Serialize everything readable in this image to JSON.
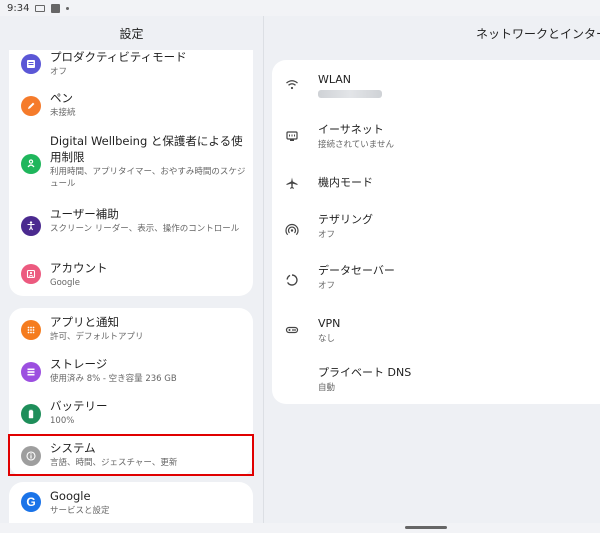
{
  "status_bar": {
    "time": "9:34"
  },
  "left_pane": {
    "title": "設定",
    "group1": [
      {
        "title": "プロダクティビティモード",
        "subtitle": "オフ",
        "icon": "list-icon",
        "color": "#5b57d6"
      },
      {
        "title": "ペン",
        "subtitle": "未接続",
        "icon": "pen-icon",
        "color": "#f57b2b"
      },
      {
        "title": "Digital Wellbeing と保護者による使用制限",
        "subtitle": "利用時間、アプリタイマー、おやすみ時間のスケジュール",
        "icon": "wellbeing-icon",
        "color": "#1fb65c"
      },
      {
        "title": "ユーザー補助",
        "subtitle": "スクリーン リーダー、表示、操作のコントロール",
        "icon": "accessibility-icon",
        "color": "#4b2a8f"
      },
      {
        "title": "アカウント",
        "subtitle": "Google",
        "icon": "account-icon",
        "color": "#ec5a7f"
      }
    ],
    "group2": [
      {
        "title": "アプリと通知",
        "subtitle": "許可、デフォルトアプリ",
        "icon": "apps-icon",
        "color": "#f57c1f"
      },
      {
        "title": "ストレージ",
        "subtitle": "使用済み 8% - 空き容量 236 GB",
        "icon": "storage-icon",
        "color": "#9c4fe0"
      },
      {
        "title": "バッテリー",
        "subtitle": "100%",
        "icon": "battery-icon",
        "color": "#1e8e5a"
      },
      {
        "title": "システム",
        "subtitle": "言語、時間、ジェスチャー、更新",
        "icon": "info-icon",
        "color": "#9e9e9e"
      }
    ],
    "group3": [
      {
        "title": "Google",
        "subtitle": "サービスと設定",
        "icon": "google-icon",
        "color": "#1a73e8"
      }
    ]
  },
  "right_pane": {
    "title": "ネットワークとインター",
    "items": [
      {
        "title": "WLAN",
        "subtitle": "",
        "icon": "wifi-icon"
      },
      {
        "title": "イーサネット",
        "subtitle": "接続されていません",
        "icon": "ethernet-icon"
      },
      {
        "title": "機内モード",
        "subtitle": "",
        "icon": "airplane-icon"
      },
      {
        "title": "テザリング",
        "subtitle": "オフ",
        "icon": "hotspot-icon"
      },
      {
        "title": "データセーバー",
        "subtitle": "オフ",
        "icon": "datasaver-icon"
      },
      {
        "title": "VPN",
        "subtitle": "なし",
        "icon": "vpn-icon"
      },
      {
        "title": "プライベート DNS",
        "subtitle": "自動",
        "icon": ""
      }
    ]
  }
}
